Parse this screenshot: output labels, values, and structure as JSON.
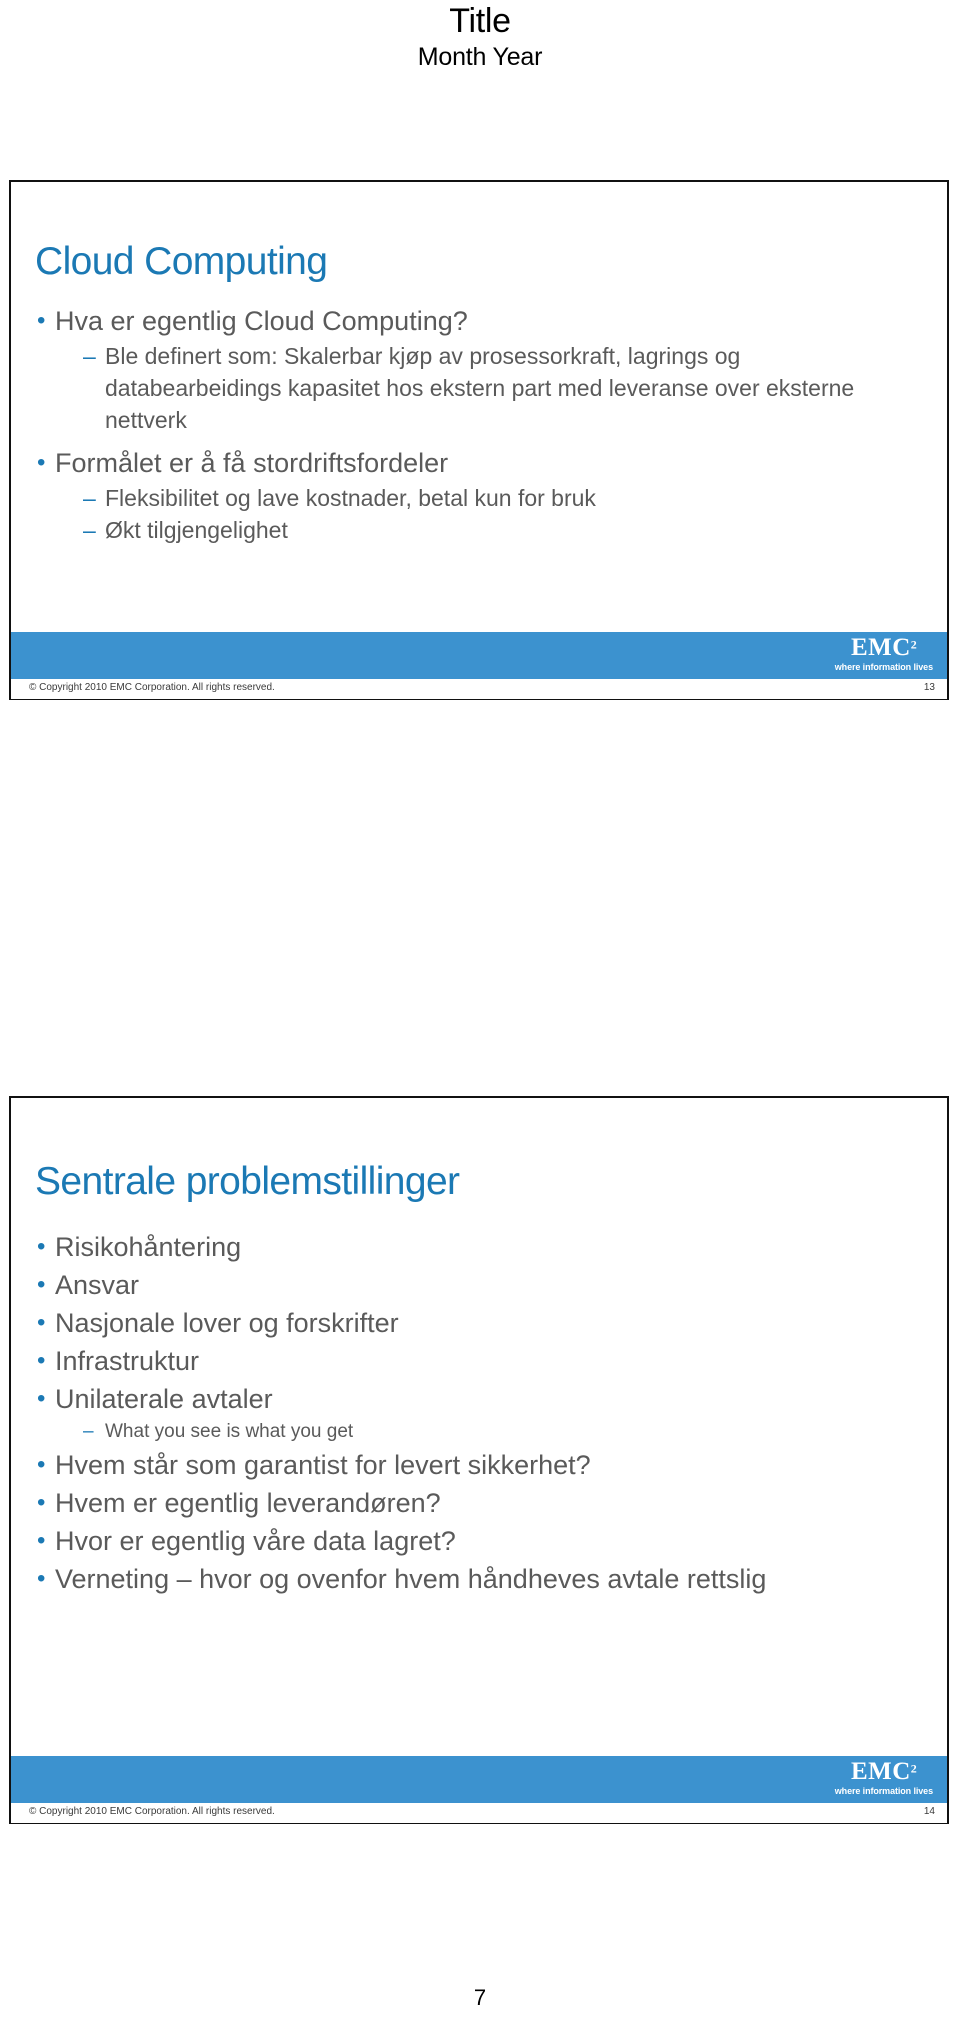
{
  "document": {
    "header": {
      "title": "Title",
      "subtitle": "Month Year"
    },
    "page_number": "7"
  },
  "colors": {
    "title_blue": "#1b79b4",
    "body_gray": "#5a5a5a",
    "footer_band": "#3c92cf",
    "bullet_blue": "#1b79b4"
  },
  "slides": [
    {
      "title": "Cloud Computing",
      "bullets": [
        {
          "level": 1,
          "marker": "•",
          "text": "Hva er egentlig Cloud Computing?"
        },
        {
          "level": 2,
          "marker": "–",
          "text": "Ble definert som: Skalerbar kjøp av prosessorkraft, lagrings og databearbeidings kapasitet hos ekstern part med leveranse over eksterne nettverk"
        },
        {
          "level": 1,
          "marker": "•",
          "text": "Formålet er å få stordriftsfordeler"
        },
        {
          "level": 2,
          "marker": "–",
          "text": "Fleksibilitet og lave kostnader, betal kun for bruk"
        },
        {
          "level": 2,
          "marker": "–",
          "text": "Økt tilgjengelighet"
        }
      ],
      "footer": {
        "logo_word": "EMC",
        "logo_sup": "2",
        "logo_tagline": "where information lives",
        "copyright": "© Copyright 2010 EMC Corporation. All rights reserved.",
        "slide_number": "13"
      }
    },
    {
      "title": "Sentrale problemstillinger",
      "bullets": [
        {
          "level": 1,
          "marker": "•",
          "text": "Risikohåntering"
        },
        {
          "level": 1,
          "marker": "•",
          "text": "Ansvar"
        },
        {
          "level": 1,
          "marker": "•",
          "text": "Nasjonale lover og forskrifter"
        },
        {
          "level": 1,
          "marker": "•",
          "text": "Infrastruktur"
        },
        {
          "level": 1,
          "marker": "•",
          "text": "Unilaterale avtaler"
        },
        {
          "level": 2,
          "marker": "–",
          "text": "What you see is what you get"
        },
        {
          "level": 1,
          "marker": "•",
          "text": "Hvem står som garantist for levert sikkerhet?"
        },
        {
          "level": 1,
          "marker": "•",
          "text": "Hvem er egentlig leverandøren?"
        },
        {
          "level": 1,
          "marker": "•",
          "text": "Hvor er egentlig våre data lagret?"
        },
        {
          "level": 1,
          "marker": "•",
          "text": "Verneting – hvor og ovenfor hvem håndheves avtale rettslig"
        }
      ],
      "footer": {
        "logo_word": "EMC",
        "logo_sup": "2",
        "logo_tagline": "where information lives",
        "copyright": "© Copyright 2010 EMC Corporation. All rights reserved.",
        "slide_number": "14"
      }
    }
  ]
}
